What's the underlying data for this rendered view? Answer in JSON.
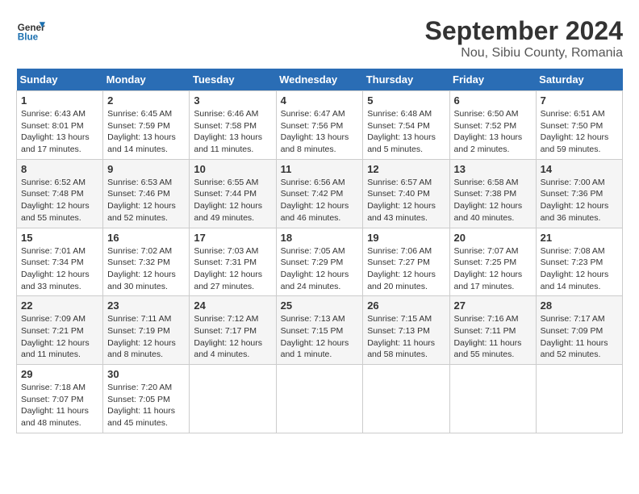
{
  "header": {
    "logo_line1": "General",
    "logo_line2": "Blue",
    "title": "September 2024",
    "subtitle": "Nou, Sibiu County, Romania"
  },
  "weekdays": [
    "Sunday",
    "Monday",
    "Tuesday",
    "Wednesday",
    "Thursday",
    "Friday",
    "Saturday"
  ],
  "weeks": [
    [
      {
        "day": "1",
        "sunrise": "6:43 AM",
        "sunset": "8:01 PM",
        "daylight": "13 hours and 17 minutes."
      },
      {
        "day": "2",
        "sunrise": "6:45 AM",
        "sunset": "7:59 PM",
        "daylight": "13 hours and 14 minutes."
      },
      {
        "day": "3",
        "sunrise": "6:46 AM",
        "sunset": "7:58 PM",
        "daylight": "13 hours and 11 minutes."
      },
      {
        "day": "4",
        "sunrise": "6:47 AM",
        "sunset": "7:56 PM",
        "daylight": "13 hours and 8 minutes."
      },
      {
        "day": "5",
        "sunrise": "6:48 AM",
        "sunset": "7:54 PM",
        "daylight": "13 hours and 5 minutes."
      },
      {
        "day": "6",
        "sunrise": "6:50 AM",
        "sunset": "7:52 PM",
        "daylight": "13 hours and 2 minutes."
      },
      {
        "day": "7",
        "sunrise": "6:51 AM",
        "sunset": "7:50 PM",
        "daylight": "12 hours and 59 minutes."
      }
    ],
    [
      {
        "day": "8",
        "sunrise": "6:52 AM",
        "sunset": "7:48 PM",
        "daylight": "12 hours and 55 minutes."
      },
      {
        "day": "9",
        "sunrise": "6:53 AM",
        "sunset": "7:46 PM",
        "daylight": "12 hours and 52 minutes."
      },
      {
        "day": "10",
        "sunrise": "6:55 AM",
        "sunset": "7:44 PM",
        "daylight": "12 hours and 49 minutes."
      },
      {
        "day": "11",
        "sunrise": "6:56 AM",
        "sunset": "7:42 PM",
        "daylight": "12 hours and 46 minutes."
      },
      {
        "day": "12",
        "sunrise": "6:57 AM",
        "sunset": "7:40 PM",
        "daylight": "12 hours and 43 minutes."
      },
      {
        "day": "13",
        "sunrise": "6:58 AM",
        "sunset": "7:38 PM",
        "daylight": "12 hours and 40 minutes."
      },
      {
        "day": "14",
        "sunrise": "7:00 AM",
        "sunset": "7:36 PM",
        "daylight": "12 hours and 36 minutes."
      }
    ],
    [
      {
        "day": "15",
        "sunrise": "7:01 AM",
        "sunset": "7:34 PM",
        "daylight": "12 hours and 33 minutes."
      },
      {
        "day": "16",
        "sunrise": "7:02 AM",
        "sunset": "7:32 PM",
        "daylight": "12 hours and 30 minutes."
      },
      {
        "day": "17",
        "sunrise": "7:03 AM",
        "sunset": "7:31 PM",
        "daylight": "12 hours and 27 minutes."
      },
      {
        "day": "18",
        "sunrise": "7:05 AM",
        "sunset": "7:29 PM",
        "daylight": "12 hours and 24 minutes."
      },
      {
        "day": "19",
        "sunrise": "7:06 AM",
        "sunset": "7:27 PM",
        "daylight": "12 hours and 20 minutes."
      },
      {
        "day": "20",
        "sunrise": "7:07 AM",
        "sunset": "7:25 PM",
        "daylight": "12 hours and 17 minutes."
      },
      {
        "day": "21",
        "sunrise": "7:08 AM",
        "sunset": "7:23 PM",
        "daylight": "12 hours and 14 minutes."
      }
    ],
    [
      {
        "day": "22",
        "sunrise": "7:09 AM",
        "sunset": "7:21 PM",
        "daylight": "12 hours and 11 minutes."
      },
      {
        "day": "23",
        "sunrise": "7:11 AM",
        "sunset": "7:19 PM",
        "daylight": "12 hours and 8 minutes."
      },
      {
        "day": "24",
        "sunrise": "7:12 AM",
        "sunset": "7:17 PM",
        "daylight": "12 hours and 4 minutes."
      },
      {
        "day": "25",
        "sunrise": "7:13 AM",
        "sunset": "7:15 PM",
        "daylight": "12 hours and 1 minute."
      },
      {
        "day": "26",
        "sunrise": "7:15 AM",
        "sunset": "7:13 PM",
        "daylight": "11 hours and 58 minutes."
      },
      {
        "day": "27",
        "sunrise": "7:16 AM",
        "sunset": "7:11 PM",
        "daylight": "11 hours and 55 minutes."
      },
      {
        "day": "28",
        "sunrise": "7:17 AM",
        "sunset": "7:09 PM",
        "daylight": "11 hours and 52 minutes."
      }
    ],
    [
      {
        "day": "29",
        "sunrise": "7:18 AM",
        "sunset": "7:07 PM",
        "daylight": "11 hours and 48 minutes."
      },
      {
        "day": "30",
        "sunrise": "7:20 AM",
        "sunset": "7:05 PM",
        "daylight": "11 hours and 45 minutes."
      },
      null,
      null,
      null,
      null,
      null
    ]
  ]
}
